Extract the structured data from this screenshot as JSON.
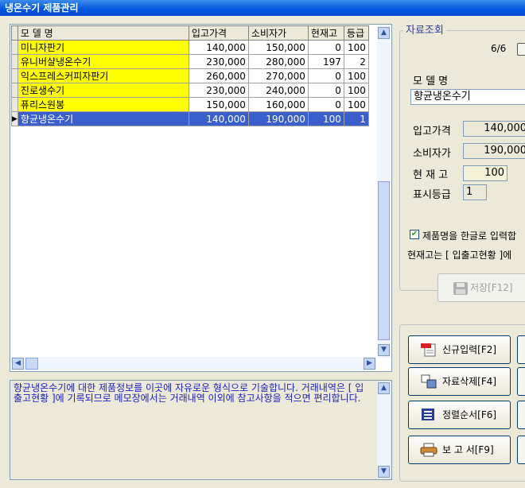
{
  "window": {
    "title": "냉온수기 제품관리"
  },
  "grid": {
    "headers": [
      "모 델 명",
      "입고가격",
      "소비자가",
      "현재고",
      "등급"
    ],
    "rows": [
      {
        "name": "미니자판기",
        "price_in": "140,000",
        "price_sale": "150,000",
        "stock": "0",
        "grade": "100"
      },
      {
        "name": "유니버샬냉온수기",
        "price_in": "230,000",
        "price_sale": "280,000",
        "stock": "197",
        "grade": "2"
      },
      {
        "name": "익스프레스커피자판기",
        "price_in": "260,000",
        "price_sale": "270,000",
        "stock": "0",
        "grade": "100"
      },
      {
        "name": "진로생수기",
        "price_in": "230,000",
        "price_sale": "240,000",
        "stock": "0",
        "grade": "100"
      },
      {
        "name": "퓨리스원봉",
        "price_in": "150,000",
        "price_sale": "160,000",
        "stock": "0",
        "grade": "100"
      },
      {
        "name": "향균냉온수기",
        "price_in": "140,000",
        "price_sale": "190,000",
        "stock": "100",
        "grade": "1"
      }
    ],
    "selected_row_marker": "▶"
  },
  "memo": {
    "text": "향균냉온수기에 대한 제품정보를 이곳에 자유로운 형식으로 기술합니다. 거래내역은 [ 입출고현황 ]에 기록되므로 메모장에서는 거래내역 이외에 참고사항을 적으면 편리합니다."
  },
  "detail": {
    "group_title": "자료조회",
    "record_position": "6/6",
    "model_label": "모 델 명",
    "model_value": "향균냉온수기",
    "price_in_label": "입고가격",
    "price_in_value": "140,000",
    "price_sale_label": "소비자가",
    "price_sale_value": "190,000",
    "stock_label": "현 재 고",
    "stock_value": "100",
    "grade_label": "표시등급",
    "grade_value": "1",
    "korean_checkbox_label": "제품명을 한글로 입력합",
    "korean_checkbox_checked": true,
    "note_text": "현재고는 [ 입출고현황 ]에",
    "save_label": "저장[F12]"
  },
  "buttons": {
    "new_label": "신규입력[F2]",
    "delete_label": "자료삭제[F4]",
    "sort_label": "정렬순서[F6]",
    "report_label": "보 고 서[F9]"
  },
  "colors": {
    "highlight": "#ffff00",
    "selection": "#3a5fcd",
    "title_bar": "#0054e3",
    "memo_text": "#2020c0"
  }
}
